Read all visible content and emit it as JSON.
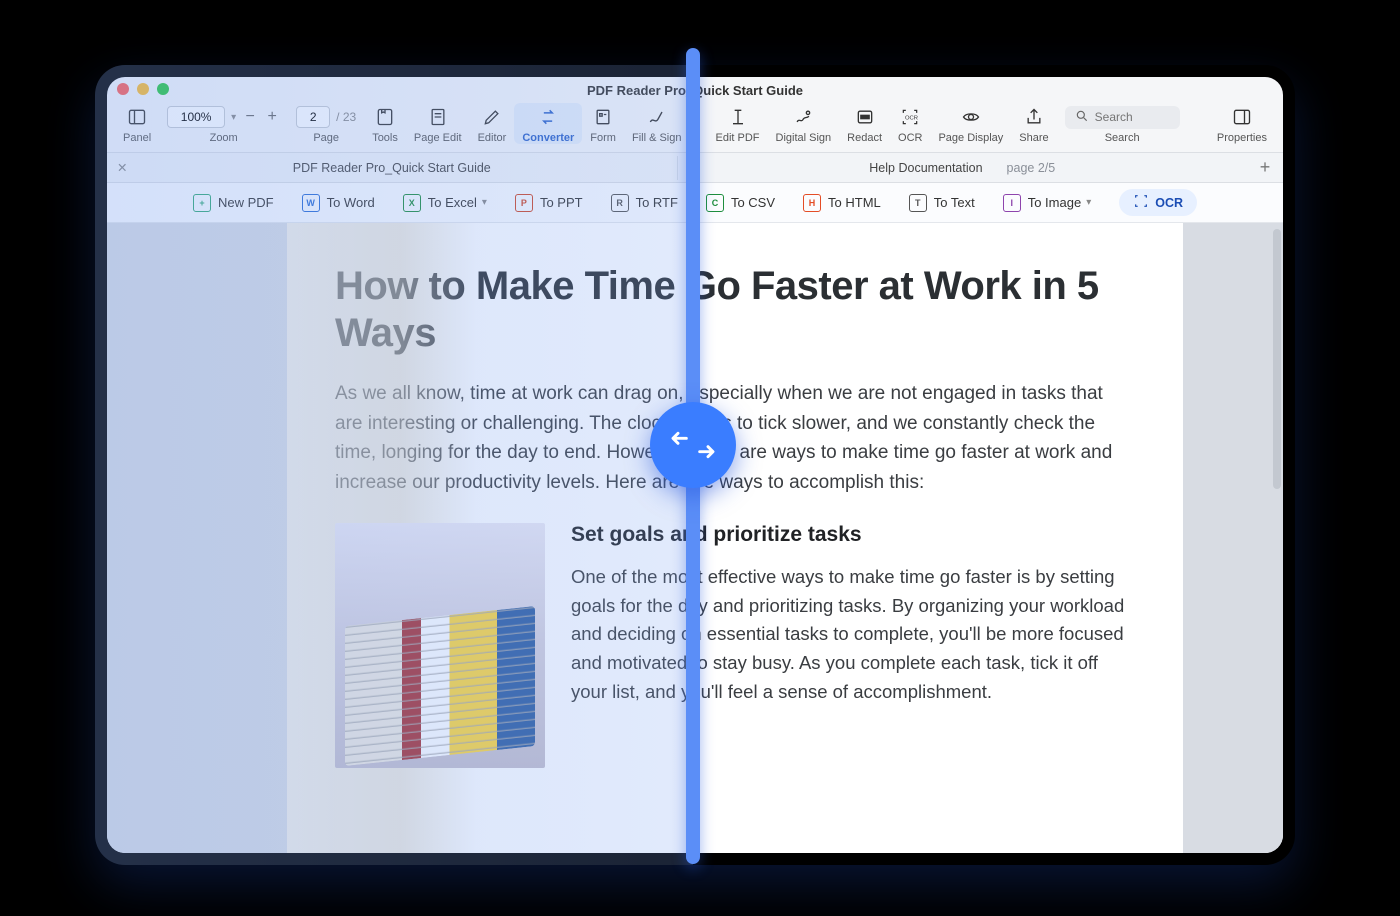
{
  "window_title": "PDF Reader Pro_Quick Start Guide",
  "toolbar": {
    "panel": "Panel",
    "zoom_label": "Zoom",
    "zoom_value": "100%",
    "page_label": "Page",
    "page_value": "2",
    "page_total": "/ 23",
    "tools": "Tools",
    "page_edit": "Page Edit",
    "editor": "Editor",
    "converter": "Converter",
    "form": "Form",
    "fill_sign": "Fill & Sign",
    "edit_pdf": "Edit PDF",
    "digital_sign": "Digital Sign",
    "redact": "Redact",
    "ocr": "OCR",
    "page_display": "Page Display",
    "share": "Share",
    "search_label": "Search",
    "search_placeholder": "Search",
    "properties": "Properties"
  },
  "tabs": {
    "tab1": "PDF Reader Pro_Quick Start Guide",
    "tab2": "Help Documentation",
    "tab2_meta": "page 2/5"
  },
  "convbar": {
    "new_pdf": "New PDF",
    "to_word": "To Word",
    "to_excel": "To Excel",
    "to_ppt": "To PPT",
    "to_rtf": "To RTF",
    "to_csv": "To CSV",
    "to_html": "To HTML",
    "to_text": "To Text",
    "to_image": "To Image",
    "ocr": "OCR",
    "badges": {
      "word": "W",
      "excel": "X",
      "ppt": "P",
      "rtf": "R",
      "csv": "C",
      "html": "H",
      "text": "T",
      "image": "I",
      "plus": "+"
    }
  },
  "doc": {
    "h1": "How to Make Time Go Faster at Work in 5 Ways",
    "intro": "As we all know, time at work can drag on, especially when we are not engaged in tasks that are interesting or challenging. The clock seems to tick slower, and we constantly check the time, longing for the day to end. However, there are ways to make time go faster at work and increase our productivity levels. Here are five ways to accomplish this:",
    "h2": "Set goals and prioritize tasks",
    "body": "One of the most effective ways to make time go faster is by setting goals for the day and prioritizing tasks. By organizing your workload and deciding on essential tasks to complete, you'll be more focused and motivated to stay busy. As you complete each task, tick it off your list, and you'll feel a sense of accomplishment."
  }
}
